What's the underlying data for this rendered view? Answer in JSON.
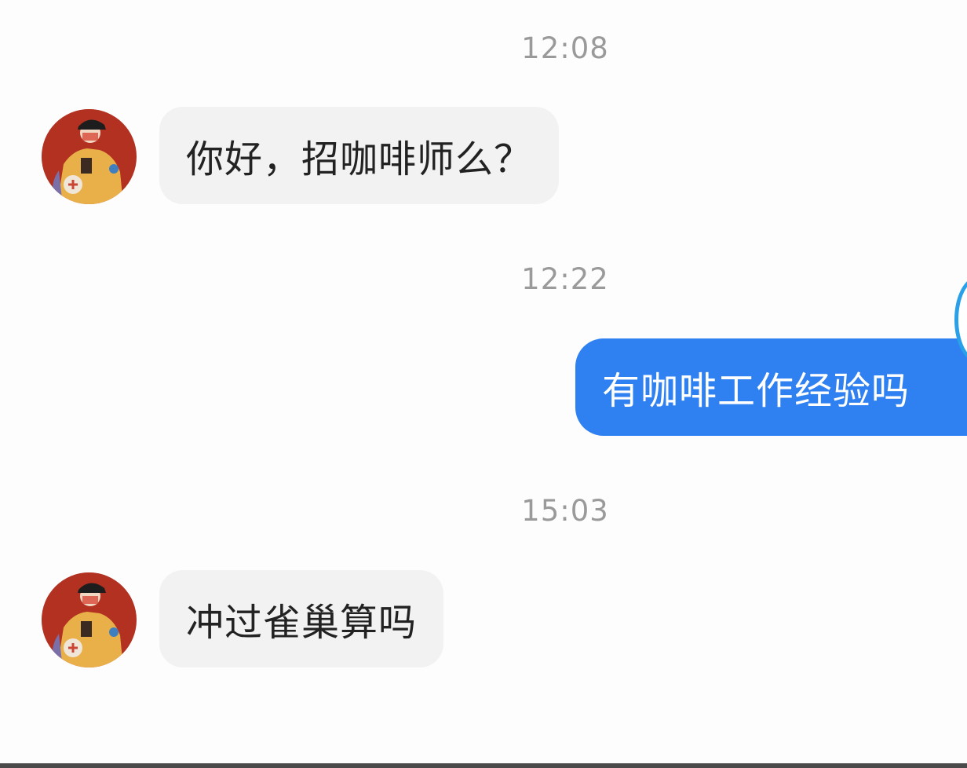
{
  "messages": [
    {
      "type": "timestamp",
      "text": "12:08"
    },
    {
      "type": "incoming",
      "text": "你好，招咖啡师么？"
    },
    {
      "type": "timestamp",
      "text": "12:22"
    },
    {
      "type": "outgoing",
      "text": "有咖啡工作经验吗"
    },
    {
      "type": "timestamp",
      "text": "15:03"
    },
    {
      "type": "incoming",
      "text": "冲过雀巢算吗"
    }
  ],
  "colors": {
    "outgoing_bubble": "#2f80f0",
    "incoming_bubble": "#f2f2f2",
    "timestamp": "#9a9a9a",
    "avatar_bg": "#b23121"
  },
  "icons": {
    "sender_avatar": "avatar-illustration-icon",
    "self_avatar": "self-avatar-icon"
  }
}
